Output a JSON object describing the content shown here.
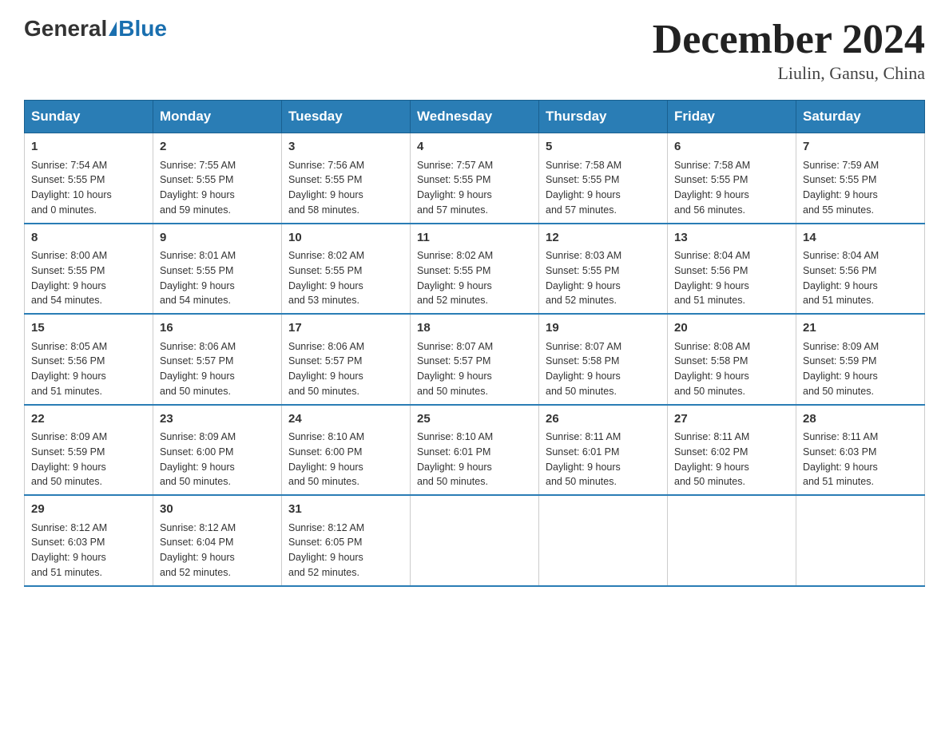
{
  "logo": {
    "general": "General",
    "blue": "Blue"
  },
  "title": "December 2024",
  "subtitle": "Liulin, Gansu, China",
  "days_header": [
    "Sunday",
    "Monday",
    "Tuesday",
    "Wednesday",
    "Thursday",
    "Friday",
    "Saturday"
  ],
  "weeks": [
    [
      {
        "day": "1",
        "sunrise": "7:54 AM",
        "sunset": "5:55 PM",
        "daylight": "10 hours and 0 minutes."
      },
      {
        "day": "2",
        "sunrise": "7:55 AM",
        "sunset": "5:55 PM",
        "daylight": "9 hours and 59 minutes."
      },
      {
        "day": "3",
        "sunrise": "7:56 AM",
        "sunset": "5:55 PM",
        "daylight": "9 hours and 58 minutes."
      },
      {
        "day": "4",
        "sunrise": "7:57 AM",
        "sunset": "5:55 PM",
        "daylight": "9 hours and 57 minutes."
      },
      {
        "day": "5",
        "sunrise": "7:58 AM",
        "sunset": "5:55 PM",
        "daylight": "9 hours and 57 minutes."
      },
      {
        "day": "6",
        "sunrise": "7:58 AM",
        "sunset": "5:55 PM",
        "daylight": "9 hours and 56 minutes."
      },
      {
        "day": "7",
        "sunrise": "7:59 AM",
        "sunset": "5:55 PM",
        "daylight": "9 hours and 55 minutes."
      }
    ],
    [
      {
        "day": "8",
        "sunrise": "8:00 AM",
        "sunset": "5:55 PM",
        "daylight": "9 hours and 54 minutes."
      },
      {
        "day": "9",
        "sunrise": "8:01 AM",
        "sunset": "5:55 PM",
        "daylight": "9 hours and 54 minutes."
      },
      {
        "day": "10",
        "sunrise": "8:02 AM",
        "sunset": "5:55 PM",
        "daylight": "9 hours and 53 minutes."
      },
      {
        "day": "11",
        "sunrise": "8:02 AM",
        "sunset": "5:55 PM",
        "daylight": "9 hours and 52 minutes."
      },
      {
        "day": "12",
        "sunrise": "8:03 AM",
        "sunset": "5:55 PM",
        "daylight": "9 hours and 52 minutes."
      },
      {
        "day": "13",
        "sunrise": "8:04 AM",
        "sunset": "5:56 PM",
        "daylight": "9 hours and 51 minutes."
      },
      {
        "day": "14",
        "sunrise": "8:04 AM",
        "sunset": "5:56 PM",
        "daylight": "9 hours and 51 minutes."
      }
    ],
    [
      {
        "day": "15",
        "sunrise": "8:05 AM",
        "sunset": "5:56 PM",
        "daylight": "9 hours and 51 minutes."
      },
      {
        "day": "16",
        "sunrise": "8:06 AM",
        "sunset": "5:57 PM",
        "daylight": "9 hours and 50 minutes."
      },
      {
        "day": "17",
        "sunrise": "8:06 AM",
        "sunset": "5:57 PM",
        "daylight": "9 hours and 50 minutes."
      },
      {
        "day": "18",
        "sunrise": "8:07 AM",
        "sunset": "5:57 PM",
        "daylight": "9 hours and 50 minutes."
      },
      {
        "day": "19",
        "sunrise": "8:07 AM",
        "sunset": "5:58 PM",
        "daylight": "9 hours and 50 minutes."
      },
      {
        "day": "20",
        "sunrise": "8:08 AM",
        "sunset": "5:58 PM",
        "daylight": "9 hours and 50 minutes."
      },
      {
        "day": "21",
        "sunrise": "8:09 AM",
        "sunset": "5:59 PM",
        "daylight": "9 hours and 50 minutes."
      }
    ],
    [
      {
        "day": "22",
        "sunrise": "8:09 AM",
        "sunset": "5:59 PM",
        "daylight": "9 hours and 50 minutes."
      },
      {
        "day": "23",
        "sunrise": "8:09 AM",
        "sunset": "6:00 PM",
        "daylight": "9 hours and 50 minutes."
      },
      {
        "day": "24",
        "sunrise": "8:10 AM",
        "sunset": "6:00 PM",
        "daylight": "9 hours and 50 minutes."
      },
      {
        "day": "25",
        "sunrise": "8:10 AM",
        "sunset": "6:01 PM",
        "daylight": "9 hours and 50 minutes."
      },
      {
        "day": "26",
        "sunrise": "8:11 AM",
        "sunset": "6:01 PM",
        "daylight": "9 hours and 50 minutes."
      },
      {
        "day": "27",
        "sunrise": "8:11 AM",
        "sunset": "6:02 PM",
        "daylight": "9 hours and 50 minutes."
      },
      {
        "day": "28",
        "sunrise": "8:11 AM",
        "sunset": "6:03 PM",
        "daylight": "9 hours and 51 minutes."
      }
    ],
    [
      {
        "day": "29",
        "sunrise": "8:12 AM",
        "sunset": "6:03 PM",
        "daylight": "9 hours and 51 minutes."
      },
      {
        "day": "30",
        "sunrise": "8:12 AM",
        "sunset": "6:04 PM",
        "daylight": "9 hours and 52 minutes."
      },
      {
        "day": "31",
        "sunrise": "8:12 AM",
        "sunset": "6:05 PM",
        "daylight": "9 hours and 52 minutes."
      },
      null,
      null,
      null,
      null
    ]
  ],
  "labels": {
    "sunrise": "Sunrise:",
    "sunset": "Sunset:",
    "daylight": "Daylight:"
  }
}
